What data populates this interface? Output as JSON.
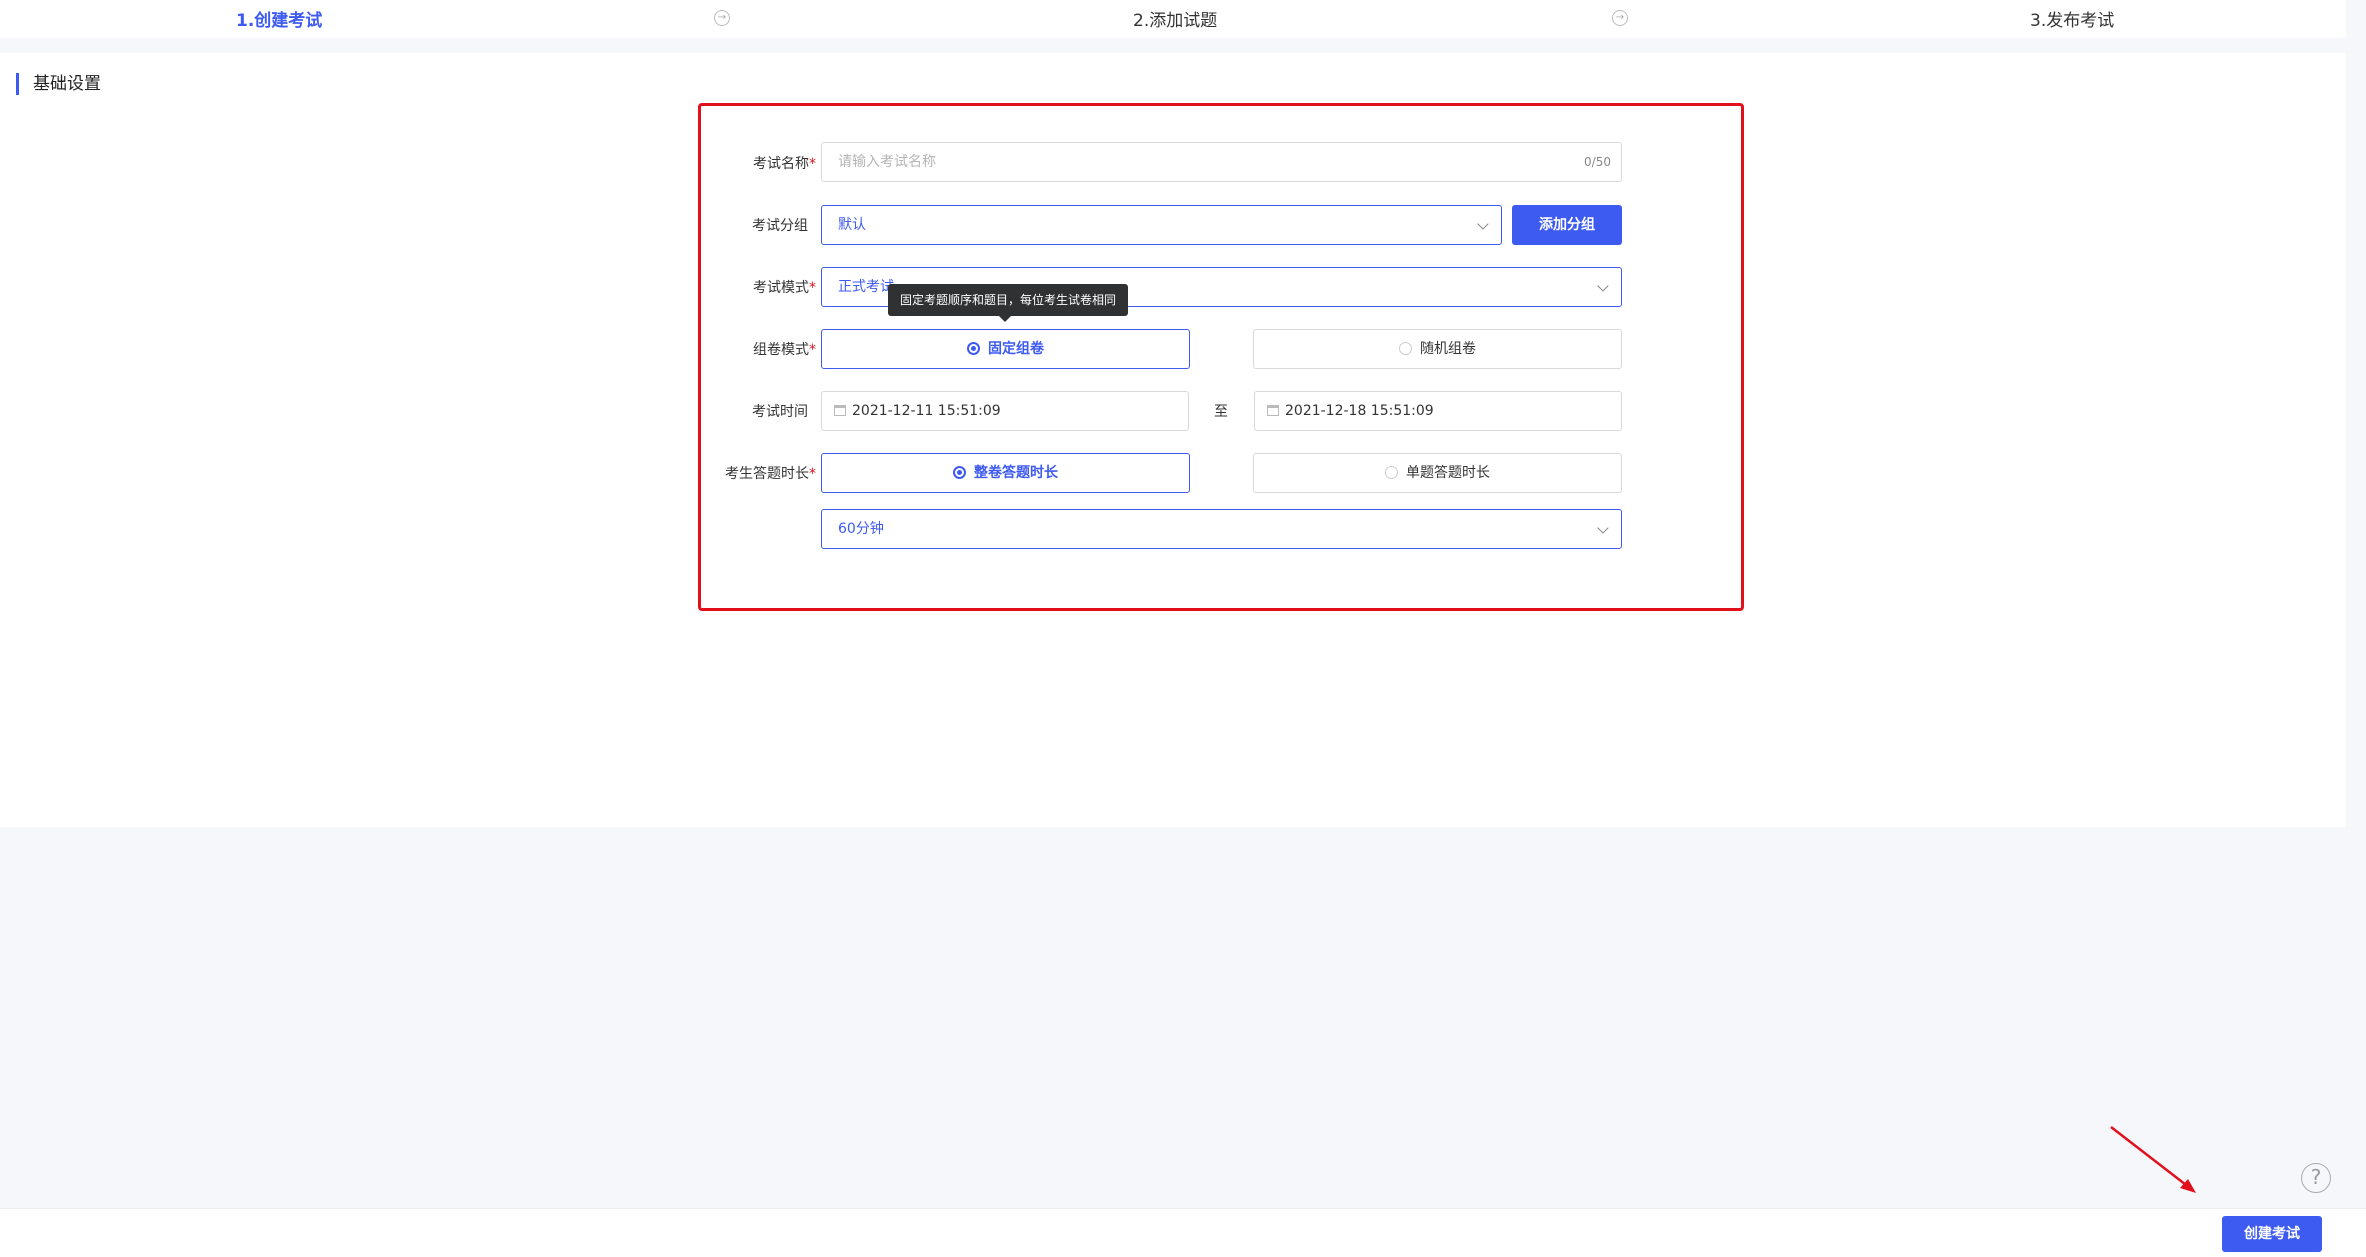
{
  "steps": [
    {
      "label": "1.创建考试"
    },
    {
      "label": "2.添加试题"
    },
    {
      "label": "3.发布考试"
    }
  ],
  "section": {
    "title": "基础设置"
  },
  "form": {
    "exam_name": {
      "label": "考试名称",
      "placeholder": "请输入考试名称",
      "count": "0/50"
    },
    "exam_group": {
      "label": "考试分组",
      "value": "默认",
      "add_button": "添加分组"
    },
    "exam_mode": {
      "label": "考试模式",
      "value": "正式考试"
    },
    "paper_mode": {
      "label": "组卷模式",
      "options": [
        "固定组卷",
        "随机组卷"
      ],
      "selected": "固定组卷",
      "tooltip": "固定考题顺序和题目，每位考生试卷相同"
    },
    "exam_time": {
      "label": "考试时间",
      "start": "2021-12-11 15:51:09",
      "to": "至",
      "end": "2021-12-18 15:51:09"
    },
    "answer_duration": {
      "label": "考生答题时长",
      "options": [
        "整卷答题时长",
        "单题答题时长"
      ],
      "selected": "整卷答题时长",
      "value": "60分钟"
    },
    "required_mark": "*"
  },
  "footer": {
    "create_button": "创建考试"
  },
  "colors": {
    "accent": "#3d5af1",
    "highlight": "#e2101a"
  }
}
